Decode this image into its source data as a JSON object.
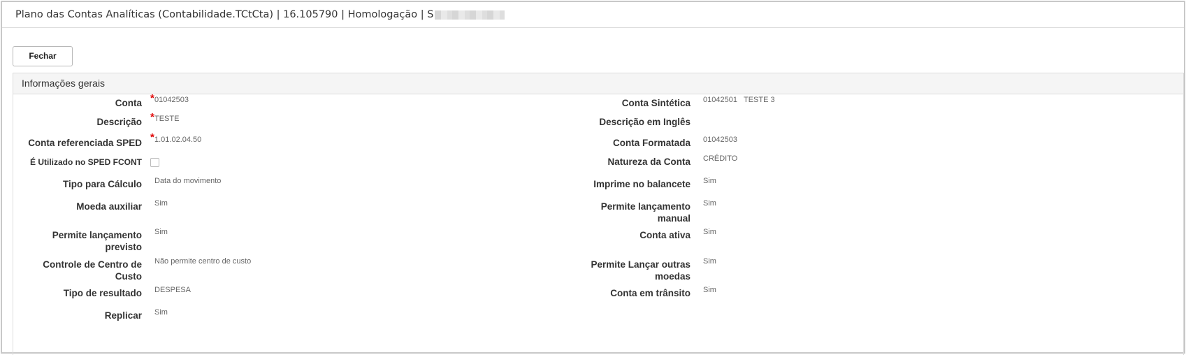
{
  "window": {
    "title": "Plano das Contas Analíticas (Contabilidade.TCtCta) | 16.105790 | Homologação | S"
  },
  "toolbar": {
    "close_label": "Fechar"
  },
  "section": {
    "title": "Informações gerais"
  },
  "left": {
    "conta": {
      "label": "Conta",
      "value": "01042503"
    },
    "descricao": {
      "label": "Descrição",
      "value": "TESTE"
    },
    "conta_ref_sped": {
      "label": "Conta referenciada SPED",
      "value": "1.01.02.04.50"
    },
    "sped_fcont": {
      "label": "É Utilizado no SPED FCONT",
      "checked": false
    },
    "tipo_calculo": {
      "label": "Tipo para Cálculo",
      "value": "Data do movimento"
    },
    "moeda_aux": {
      "label": "Moeda auxiliar",
      "value": "Sim"
    },
    "lanc_previsto": {
      "label": "Permite lançamento previsto",
      "value": "Sim"
    },
    "centro_custo": {
      "label": "Controle de Centro de Custo",
      "value": "Não permite centro de custo"
    },
    "tipo_resultado": {
      "label": "Tipo de resultado",
      "value": "DESPESA"
    },
    "replicar": {
      "label": "Replicar",
      "value": "Sim"
    }
  },
  "right": {
    "conta_sintetica": {
      "label": "Conta Sintética",
      "code": "01042501",
      "name": "TESTE 3"
    },
    "desc_ingles": {
      "label": "Descrição em Inglês",
      "value": ""
    },
    "conta_formatada": {
      "label": "Conta Formatada",
      "value": "01042503"
    },
    "natureza": {
      "label": "Natureza da Conta",
      "value": "CRÉDITO"
    },
    "imprime_balancete": {
      "label": "Imprime no balancete",
      "value": "Sim"
    },
    "lanc_manual": {
      "label": "Permite lançamento manual",
      "value": "Sim"
    },
    "conta_ativa": {
      "label": "Conta ativa",
      "value": "Sim"
    },
    "outras_moedas": {
      "label": "Permite Lançar outras moedas",
      "value": "Sim"
    },
    "conta_transito": {
      "label": "Conta em trânsito",
      "value": "Sim"
    }
  },
  "required_mark": "*"
}
